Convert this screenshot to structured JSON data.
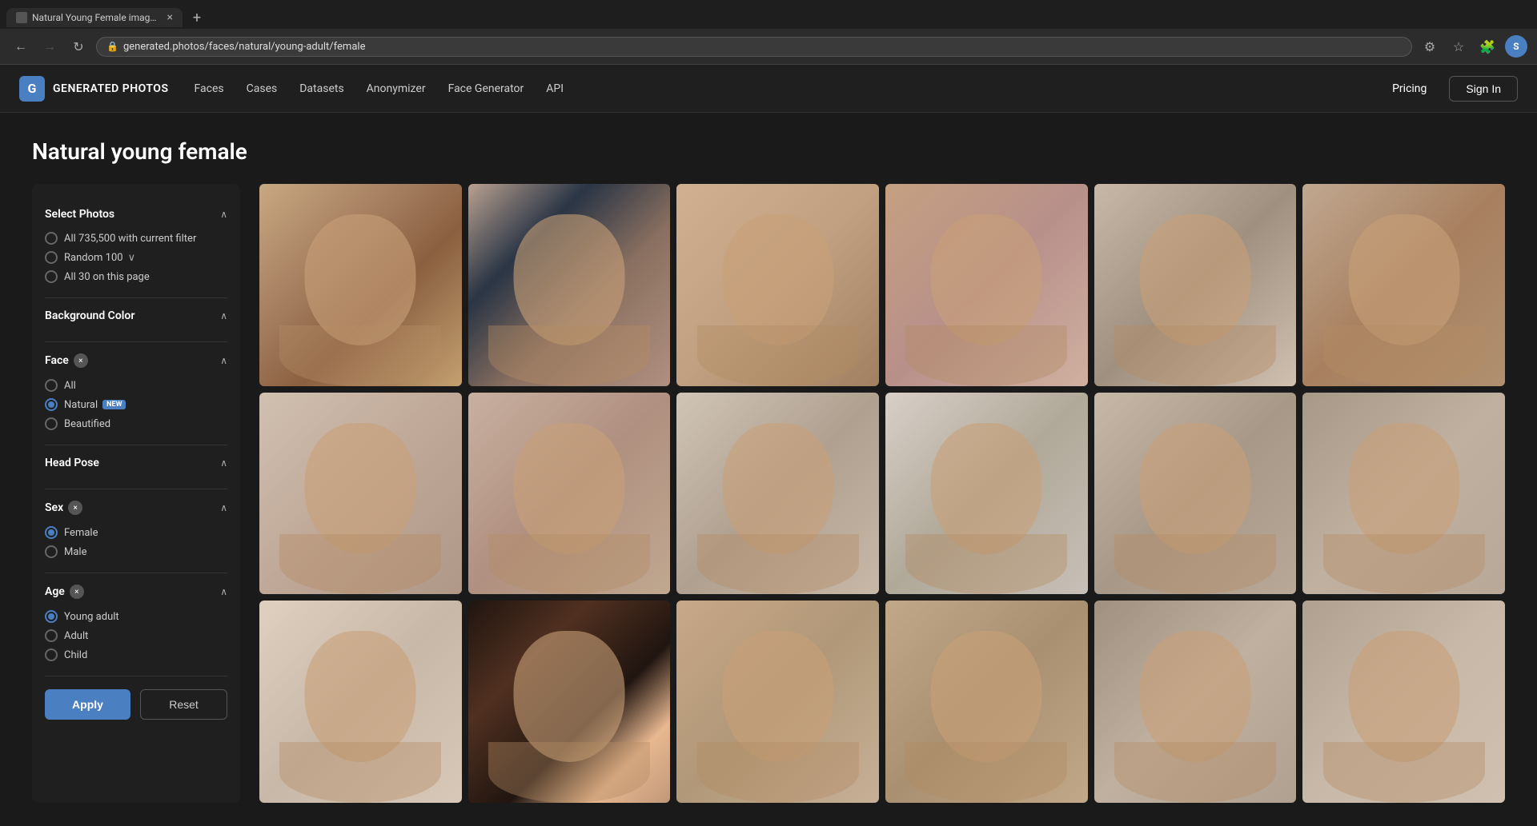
{
  "browser": {
    "tab_title": "Natural Young Female images |",
    "url": "generated.photos/faces/natural/young-adult/female",
    "new_tab_label": "+",
    "back_disabled": false,
    "forward_disabled": true,
    "refresh_label": "↻"
  },
  "app": {
    "logo_text": "GENERATED PHOTOS",
    "logo_initial": "G",
    "nav_items": [
      "Faces",
      "Cases",
      "Datasets",
      "Anonymizer",
      "Face Generator",
      "API"
    ],
    "pricing_label": "Pricing",
    "signin_label": "Sign In"
  },
  "page": {
    "title": "Natural young female"
  },
  "sidebar": {
    "select_photos_title": "Select Photos",
    "select_photos_chevron": "∧",
    "options": [
      {
        "id": "all-filter",
        "label": "All 735,500 with current filter",
        "checked": false
      },
      {
        "id": "random-100",
        "label": "Random 100",
        "checked": false,
        "has_dropdown": true
      },
      {
        "id": "all-30",
        "label": "All 30 on this page",
        "checked": false
      }
    ],
    "background_color_title": "Background Color",
    "background_chevron": "∧",
    "face_title": "Face",
    "face_chevron": "∧",
    "face_badge": "×",
    "face_options": [
      {
        "id": "face-all",
        "label": "All",
        "checked": false
      },
      {
        "id": "face-natural",
        "label": "Natural",
        "checked": true,
        "badge": "NEW"
      },
      {
        "id": "face-beautified",
        "label": "Beautified",
        "checked": false
      }
    ],
    "head_pose_title": "Head Pose",
    "head_pose_chevron": "∧",
    "sex_title": "Sex",
    "sex_chevron": "∧",
    "sex_badge": "×",
    "sex_options": [
      {
        "id": "sex-female",
        "label": "Female",
        "checked": true
      },
      {
        "id": "sex-male",
        "label": "Male",
        "checked": false
      }
    ],
    "age_title": "Age",
    "age_chevron": "∧",
    "age_badge": "×",
    "age_options": [
      {
        "id": "age-young-adult",
        "label": "Young adult",
        "checked": true
      },
      {
        "id": "age-adult",
        "label": "Adult",
        "checked": false
      },
      {
        "id": "age-child",
        "label": "Child",
        "checked": false
      }
    ],
    "apply_label": "Apply",
    "reset_label": "Reset"
  },
  "photos": {
    "faces": [
      "face-1",
      "face-2",
      "face-3",
      "face-4",
      "face-5",
      "face-6",
      "face-7",
      "face-8",
      "face-9",
      "face-10",
      "face-11",
      "face-12",
      "face-13",
      "face-14",
      "face-15",
      "face-16",
      "face-17",
      "face-18"
    ]
  }
}
